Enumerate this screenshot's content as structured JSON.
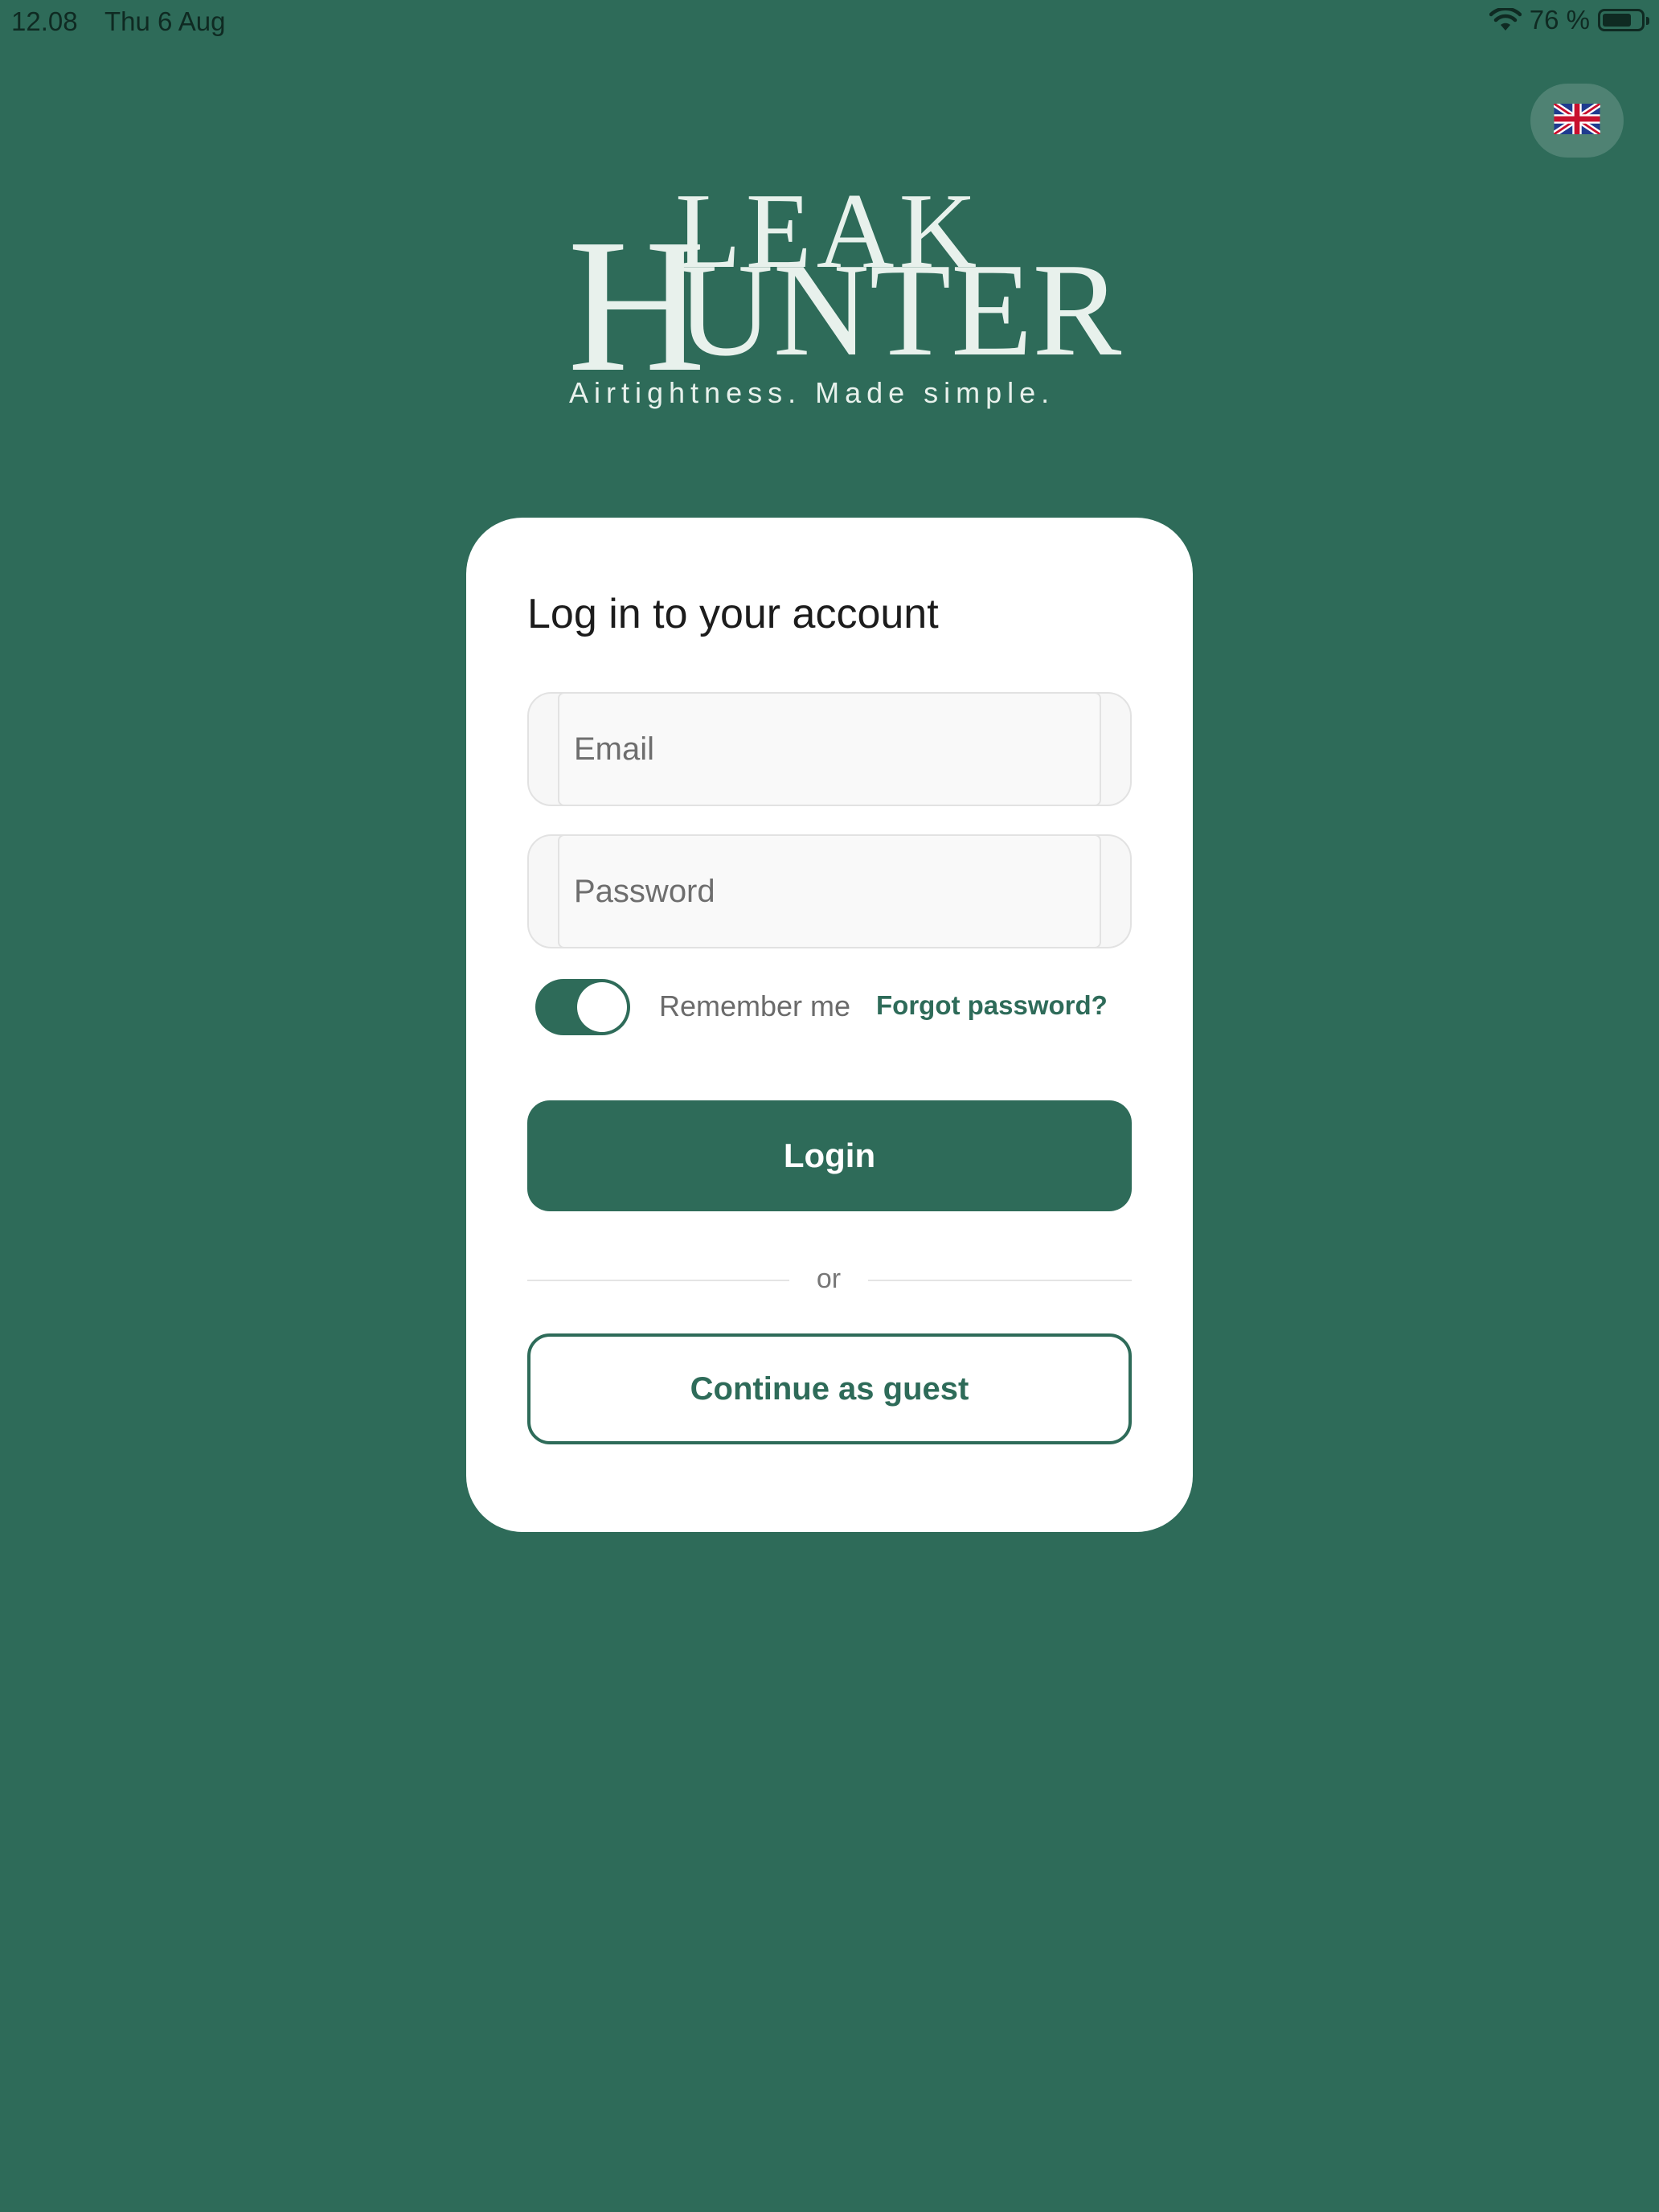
{
  "status_bar": {
    "time": "12.08",
    "date": "Thu 6 Aug",
    "battery_text": "76 %",
    "battery_level": 0.76
  },
  "language": {
    "selected": "uk-flag-icon"
  },
  "logo": {
    "h": "H",
    "leak": "LEAK",
    "unter": "UNTER",
    "tagline": "Airtightness. Made simple."
  },
  "login_card": {
    "title": "Log in to your account",
    "email_placeholder": "Email",
    "email_value": "",
    "password_placeholder": "Password",
    "password_value": "",
    "remember_me_label": "Remember me",
    "remember_me_on": true,
    "forgot_password": "Forgot password?",
    "login_label": "Login",
    "divider_text": "or",
    "guest_label": "Continue as guest"
  },
  "colors": {
    "brand": "#2e6b59",
    "card": "#ffffff",
    "text": "#1c1c1c"
  }
}
